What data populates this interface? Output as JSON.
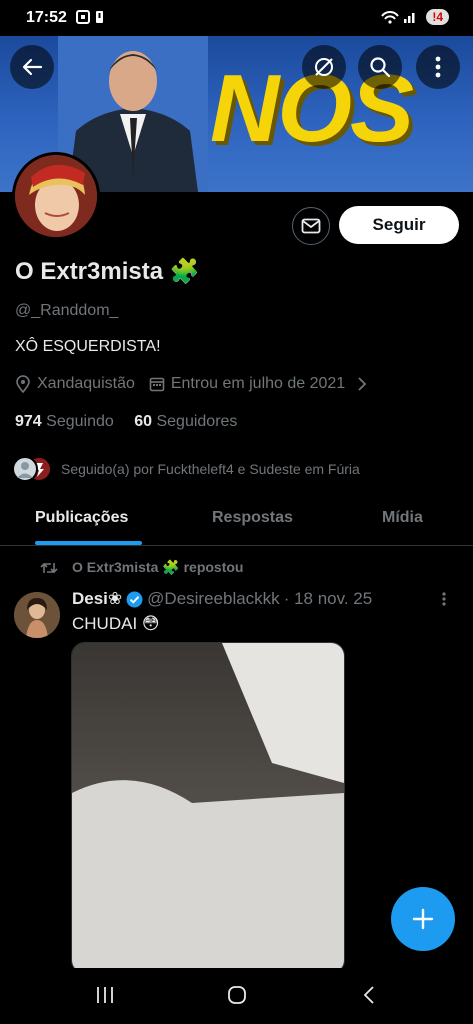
{
  "status_bar": {
    "time": "17:52",
    "notification_count": "4"
  },
  "banner": {
    "text": "NOS"
  },
  "profile": {
    "name": "O Extr3mista",
    "name_emoji": "🧩",
    "handle": "@_Randdom_",
    "bio": "XÔ ESQUERDISTA!",
    "location": "Xandaquistão",
    "joined": "Entrou em julho de 2021",
    "following_count": "974",
    "following_label": "Seguindo",
    "followers_count": "60",
    "followers_label": "Seguidores",
    "followed_by": "Seguido(a) por Fucktheleft4 e Sudeste em Fúria"
  },
  "actions": {
    "follow_label": "Seguir"
  },
  "tabs": [
    {
      "label": "Publicações",
      "active": true
    },
    {
      "label": "Respostas",
      "active": false
    },
    {
      "label": "Mídia",
      "active": false
    }
  ],
  "post": {
    "repost_text": "O Extr3mista 🧩 repostou",
    "author_name": "Desi❀",
    "author_handle": "@Desireeblackkk",
    "date": "· 18 nov. 25",
    "text": "CHUDAI 😳"
  },
  "colors": {
    "accent": "#1d9bf0",
    "banner_yellow": "#f5d50a",
    "banner_blue": "#2e64bf"
  },
  "icons": [
    "back-arrow-icon",
    "no-sync-icon",
    "search-icon",
    "more-vertical-icon",
    "mail-icon",
    "location-icon",
    "calendar-icon",
    "chevron-right-icon",
    "repost-icon",
    "verified-icon",
    "compose-plus-icon",
    "recents-icon",
    "home-icon",
    "back-nav-icon"
  ]
}
